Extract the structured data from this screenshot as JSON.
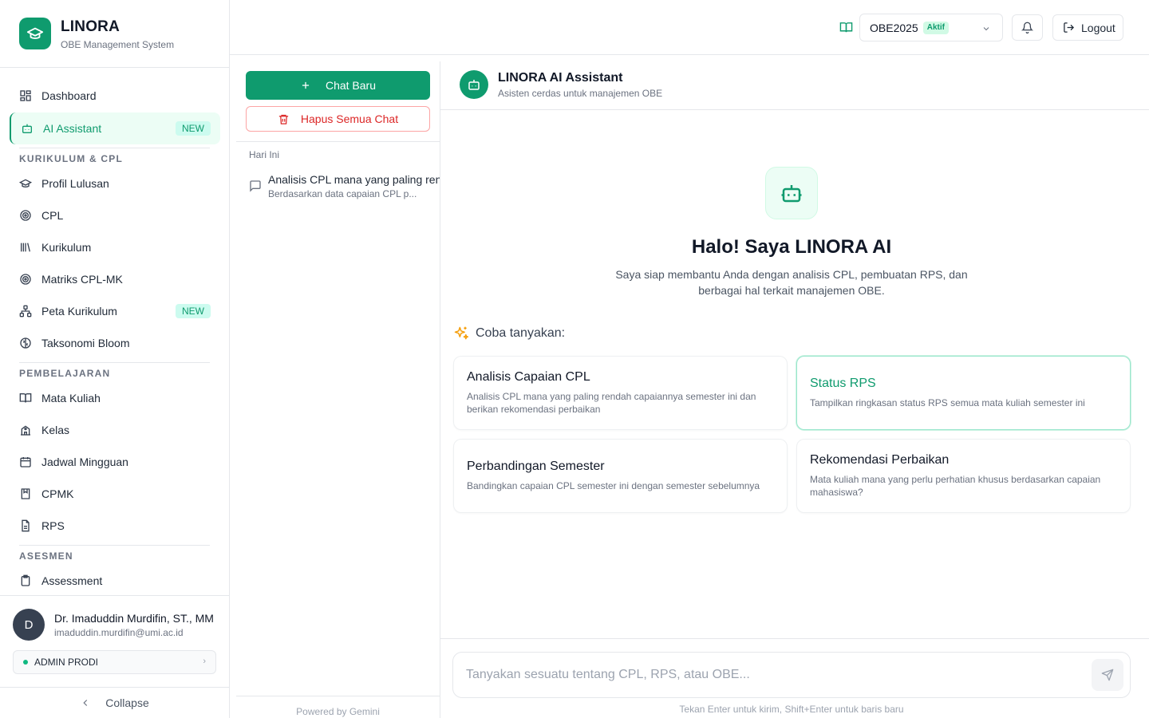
{
  "brand": {
    "title": "LINORA",
    "subtitle": "OBE Management System"
  },
  "nav": {
    "dashboard": "Dashboard",
    "ai_assistant": "AI Assistant",
    "ai_badge": "NEW",
    "section_kurikulum": "KURIKULUM & CPL",
    "profil_lulusan": "Profil Lulusan",
    "cpl": "CPL",
    "kurikulum": "Kurikulum",
    "matriks": "Matriks CPL-MK",
    "peta": "Peta Kurikulum",
    "peta_badge": "NEW",
    "taksonomi": "Taksonomi Bloom",
    "section_pembelajaran": "PEMBELAJARAN",
    "mata_kuliah": "Mata Kuliah",
    "kelas": "Kelas",
    "jadwal": "Jadwal Mingguan",
    "cpmk": "CPMK",
    "rps": "RPS",
    "section_asesmen": "ASESMEN",
    "assessment": "Assessment"
  },
  "user": {
    "initial": "D",
    "name": "Dr. Imaduddin Murdifin, ST., MM",
    "email": "imaduddin.murdifin@umi.ac.id",
    "role": "ADMIN PRODI"
  },
  "collapse_label": "Collapse",
  "header": {
    "curriculum": "OBE2025",
    "curriculum_status": "Aktif",
    "logout": "Logout"
  },
  "history": {
    "new_chat": "Chat Baru",
    "clear_all": "Hapus Semua Chat",
    "group_today": "Hari Ini",
    "items": [
      {
        "title": "Analisis CPL mana yang paling rendah",
        "subtitle": "Berdasarkan data capaian CPL p..."
      }
    ],
    "powered_by": "Powered by Gemini"
  },
  "chat": {
    "title": "LINORA AI Assistant",
    "subtitle": "Asisten cerdas untuk manajemen OBE",
    "hero_title": "Halo! Saya LINORA AI",
    "hero_desc": "Saya siap membantu Anda dengan analisis CPL, pembuatan RPS, dan berbagai hal terkait manajemen OBE.",
    "try_label": "Coba tanyakan:",
    "suggestions": [
      {
        "title": "Analisis Capaian CPL",
        "desc": "Analisis CPL mana yang paling rendah capaiannya semester ini dan berikan rekomendasi perbaikan"
      },
      {
        "title": "Status RPS",
        "desc": "Tampilkan ringkasan status RPS semua mata kuliah semester ini"
      },
      {
        "title": "Perbandingan Semester",
        "desc": "Bandingkan capaian CPL semester ini dengan semester sebelumnya"
      },
      {
        "title": "Rekomendasi Perbaikan",
        "desc": "Mata kuliah mana yang perlu perhatian khusus berdasarkan capaian mahasiswa?"
      }
    ],
    "input_placeholder": "Tanyakan sesuatu tentang CPL, RPS, atau OBE...",
    "hint": "Tekan Enter untuk kirim, Shift+Enter untuk baris baru"
  },
  "colors": {
    "accent": "#0f9b6e",
    "danger": "#dc2626"
  }
}
